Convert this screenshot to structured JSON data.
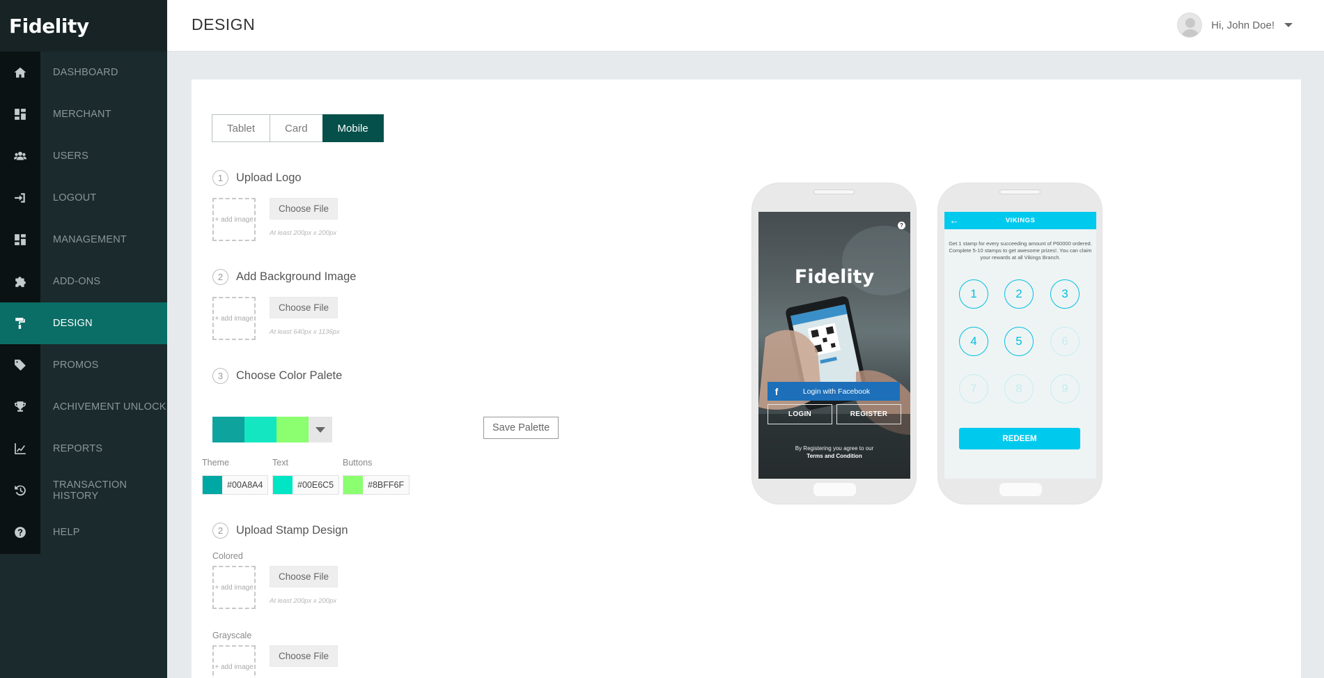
{
  "brand": "Fidelity",
  "page_title": "DESIGN",
  "user": {
    "greeting": "Hi, John Doe!"
  },
  "nav": [
    {
      "label": "DASHBOARD",
      "icon": "home-icon"
    },
    {
      "label": "MERCHANT",
      "icon": "dashboard-grid-icon"
    },
    {
      "label": "USERS",
      "icon": "users-icon"
    },
    {
      "label": "LOGOUT",
      "icon": "sign-in-icon"
    },
    {
      "label": "MANAGEMENT",
      "icon": "dashboard-grid-icon"
    },
    {
      "label": "ADD-ONS",
      "icon": "puzzle-icon"
    },
    {
      "label": "DESIGN",
      "icon": "paint-roller-icon",
      "active": true
    },
    {
      "label": "PROMOS",
      "icon": "tags-icon"
    },
    {
      "label": "ACHIVEMENT UNLOCK",
      "icon": "trophy-icon"
    },
    {
      "label": "REPORTS",
      "icon": "line-chart-icon"
    },
    {
      "label": "TRANSACTION HISTORY",
      "icon": "history-icon"
    },
    {
      "label": "HELP",
      "icon": "question-icon"
    }
  ],
  "tabs": [
    {
      "label": "Tablet"
    },
    {
      "label": "Card"
    },
    {
      "label": "Mobile",
      "active": true
    }
  ],
  "steps": {
    "logo": {
      "num": "1",
      "label": "Upload Logo",
      "hint": "At least 200px x 200px"
    },
    "background": {
      "num": "2",
      "label": "Add Background Image",
      "hint": "At least 640px x 1136px"
    },
    "palette": {
      "num": "3",
      "label": "Choose Color Palete"
    },
    "stamp": {
      "num": "2",
      "label": "Upload Stamp Design",
      "colored_label": "Colored",
      "colored_hint": "At least 200px x 200px",
      "grayscale_label": "Grayscale"
    }
  },
  "upload": {
    "add_image": "+ add image",
    "choose_file": "Choose File"
  },
  "palette": {
    "swatches": [
      "#0FA39E",
      "#15E6C2",
      "#8BFF6F"
    ],
    "save_label": "Save Palette",
    "theme": {
      "label": "Theme",
      "value": "#00A8A4",
      "color": "#00A8A4"
    },
    "text": {
      "label": "Text",
      "value": "#00E6C5",
      "color": "#00E6C5"
    },
    "buttons": {
      "label": "Buttons",
      "value": "#8BFF6F",
      "color": "#8BFF6F"
    }
  },
  "preview_login": {
    "title": "Fidelity",
    "help": "?",
    "facebook": "Login with Facebook",
    "login": "LOGIN",
    "register": "REGISTER",
    "terms_intro": "By Registering you agree to our",
    "terms_link": "Terms and Condition"
  },
  "preview_stamps": {
    "back": "←",
    "title": "VIKINGS",
    "description": "Get 1 stamp for every succeeding amount of P60000 ordered. Complete 5-10 stamps to get awesome prizes!. You can claim your rewards at all Vikings Branch.",
    "stamps": [
      {
        "n": "1",
        "filled": true
      },
      {
        "n": "2",
        "filled": true
      },
      {
        "n": "3",
        "filled": true
      },
      {
        "n": "4",
        "filled": true
      },
      {
        "n": "5",
        "filled": true
      },
      {
        "n": "6",
        "filled": false
      },
      {
        "n": "7",
        "filled": false
      },
      {
        "n": "8",
        "filled": false
      },
      {
        "n": "9",
        "filled": false
      }
    ],
    "redeem": "REDEEM"
  }
}
